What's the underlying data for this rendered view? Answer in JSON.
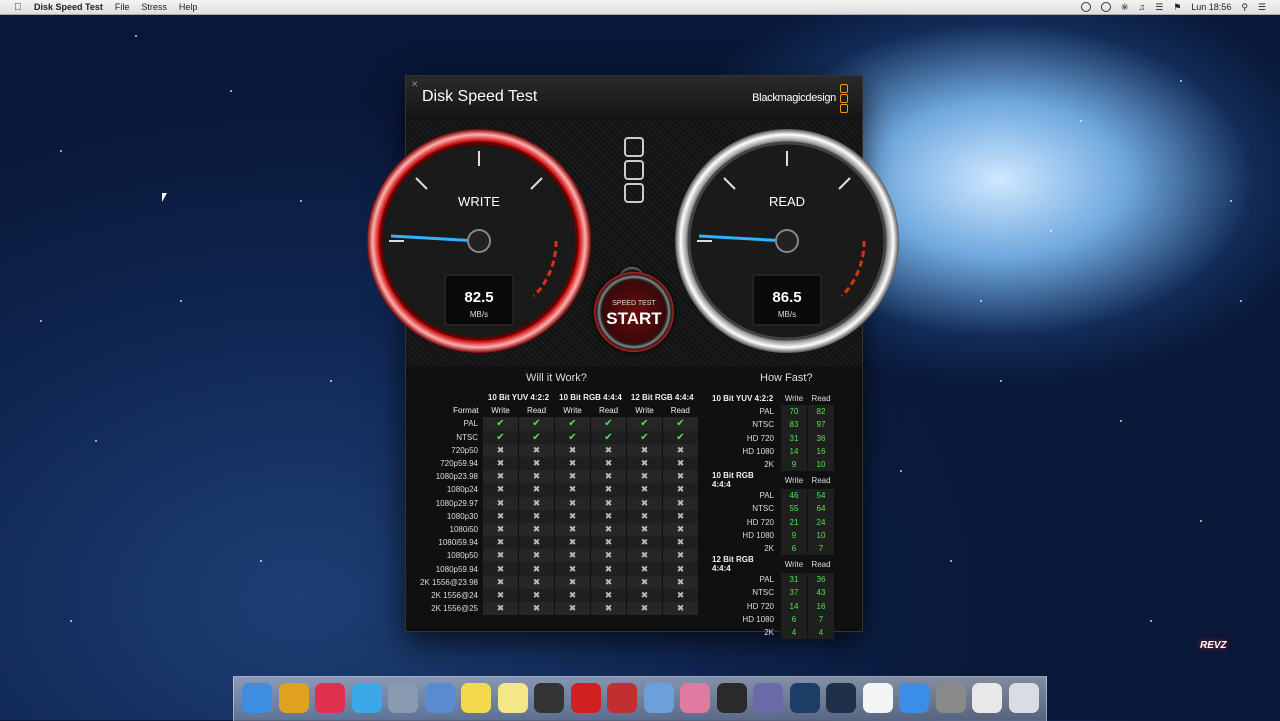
{
  "menubar": {
    "app_name": "Disk Speed Test",
    "menus": [
      "File",
      "Stress",
      "Help"
    ],
    "clock": "Lun 18:56"
  },
  "window": {
    "title": "Disk Speed Test",
    "brand": "Blackmagicdesign"
  },
  "gauges": {
    "write": {
      "label": "WRITE",
      "value": "82.5",
      "unit": "MB/s"
    },
    "read": {
      "label": "READ",
      "value": "86.5",
      "unit": "MB/s"
    }
  },
  "start_button": {
    "line1": "SPEED TEST",
    "line2": "START"
  },
  "will_it_work": {
    "title": "Will it Work?",
    "groups": [
      "10 Bit YUV 4:2:2",
      "10 Bit RGB 4:4:4",
      "12 Bit RGB 4:4:4"
    ],
    "format_label": "Format",
    "sub_headers": [
      "Write",
      "Read",
      "Write",
      "Read",
      "Write",
      "Read"
    ],
    "rows": [
      {
        "format": "PAL",
        "ok": [
          true,
          true,
          true,
          true,
          true,
          true
        ]
      },
      {
        "format": "NTSC",
        "ok": [
          true,
          true,
          true,
          true,
          true,
          true
        ]
      },
      {
        "format": "720p50",
        "ok": [
          false,
          false,
          false,
          false,
          false,
          false
        ]
      },
      {
        "format": "720p59.94",
        "ok": [
          false,
          false,
          false,
          false,
          false,
          false
        ]
      },
      {
        "format": "1080p23.98",
        "ok": [
          false,
          false,
          false,
          false,
          false,
          false
        ]
      },
      {
        "format": "1080p24",
        "ok": [
          false,
          false,
          false,
          false,
          false,
          false
        ]
      },
      {
        "format": "1080p29.97",
        "ok": [
          false,
          false,
          false,
          false,
          false,
          false
        ]
      },
      {
        "format": "1080p30",
        "ok": [
          false,
          false,
          false,
          false,
          false,
          false
        ]
      },
      {
        "format": "1080i50",
        "ok": [
          false,
          false,
          false,
          false,
          false,
          false
        ]
      },
      {
        "format": "1080i59.94",
        "ok": [
          false,
          false,
          false,
          false,
          false,
          false
        ]
      },
      {
        "format": "1080p50",
        "ok": [
          false,
          false,
          false,
          false,
          false,
          false
        ]
      },
      {
        "format": "1080p59.94",
        "ok": [
          false,
          false,
          false,
          false,
          false,
          false
        ]
      },
      {
        "format": "2K 1556@23.98",
        "ok": [
          false,
          false,
          false,
          false,
          false,
          false
        ]
      },
      {
        "format": "2K 1556@24",
        "ok": [
          false,
          false,
          false,
          false,
          false,
          false
        ]
      },
      {
        "format": "2K 1556@25",
        "ok": [
          false,
          false,
          false,
          false,
          false,
          false
        ]
      }
    ]
  },
  "how_fast": {
    "title": "How Fast?",
    "col_write": "Write",
    "col_read": "Read",
    "groups": [
      {
        "name": "10 Bit YUV 4:2:2",
        "rows": [
          {
            "format": "PAL",
            "write": "70",
            "read": "82"
          },
          {
            "format": "NTSC",
            "write": "83",
            "read": "97"
          },
          {
            "format": "HD 720",
            "write": "31",
            "read": "36"
          },
          {
            "format": "HD 1080",
            "write": "14",
            "read": "16"
          },
          {
            "format": "2K",
            "write": "9",
            "read": "10"
          }
        ]
      },
      {
        "name": "10 Bit RGB 4:4:4",
        "rows": [
          {
            "format": "PAL",
            "write": "46",
            "read": "54"
          },
          {
            "format": "NTSC",
            "write": "55",
            "read": "64"
          },
          {
            "format": "HD 720",
            "write": "21",
            "read": "24"
          },
          {
            "format": "HD 1080",
            "write": "9",
            "read": "10"
          },
          {
            "format": "2K",
            "write": "6",
            "read": "7"
          }
        ]
      },
      {
        "name": "12 Bit RGB 4:4:4",
        "rows": [
          {
            "format": "PAL",
            "write": "31",
            "read": "36"
          },
          {
            "format": "NTSC",
            "write": "37",
            "read": "43"
          },
          {
            "format": "HD 720",
            "write": "14",
            "read": "16"
          },
          {
            "format": "HD 1080",
            "write": "6",
            "read": "7"
          },
          {
            "format": "2K",
            "write": "4",
            "read": "4"
          }
        ]
      }
    ]
  },
  "dock": {
    "apps": [
      {
        "icon": "finder-icon",
        "color": "#3d8ee0"
      },
      {
        "icon": "chrome-icon",
        "color": "#e0a020"
      },
      {
        "icon": "itunes-icon",
        "color": "#e03050"
      },
      {
        "icon": "twitter-icon",
        "color": "#3ba8e8"
      },
      {
        "icon": "launchpad-icon",
        "color": "#8a9ab0"
      },
      {
        "icon": "preview-icon",
        "color": "#5a8ad0"
      },
      {
        "icon": "stickies-icon",
        "color": "#f2d94e"
      },
      {
        "icon": "notes-icon",
        "color": "#f5e68a"
      },
      {
        "icon": "disk-speed-test-icon",
        "color": "#333333"
      },
      {
        "icon": "target-icon",
        "color": "#d02020"
      },
      {
        "icon": "photo-booth-icon",
        "color": "#c03030"
      },
      {
        "icon": "image-capture-icon",
        "color": "#6ca0d8"
      },
      {
        "icon": "photos-icon",
        "color": "#e07aa0"
      },
      {
        "icon": "final-cut-icon",
        "color": "#2a2a2a"
      },
      {
        "icon": "imovie-icon",
        "color": "#6a6aa8"
      },
      {
        "icon": "photoshop-icon",
        "color": "#1d3c66"
      },
      {
        "icon": "cinema4d-icon",
        "color": "#20304a"
      },
      {
        "icon": "calendar-icon",
        "color": "#f5f5f5"
      },
      {
        "icon": "app-store-icon",
        "color": "#3a8ee8"
      },
      {
        "icon": "system-preferences-icon",
        "color": "#8a8a8a"
      },
      {
        "icon": "documents-icon",
        "color": "#e8e8e8"
      },
      {
        "icon": "trash-icon",
        "color": "#d8dde5"
      }
    ]
  },
  "watermark": "REVZ"
}
